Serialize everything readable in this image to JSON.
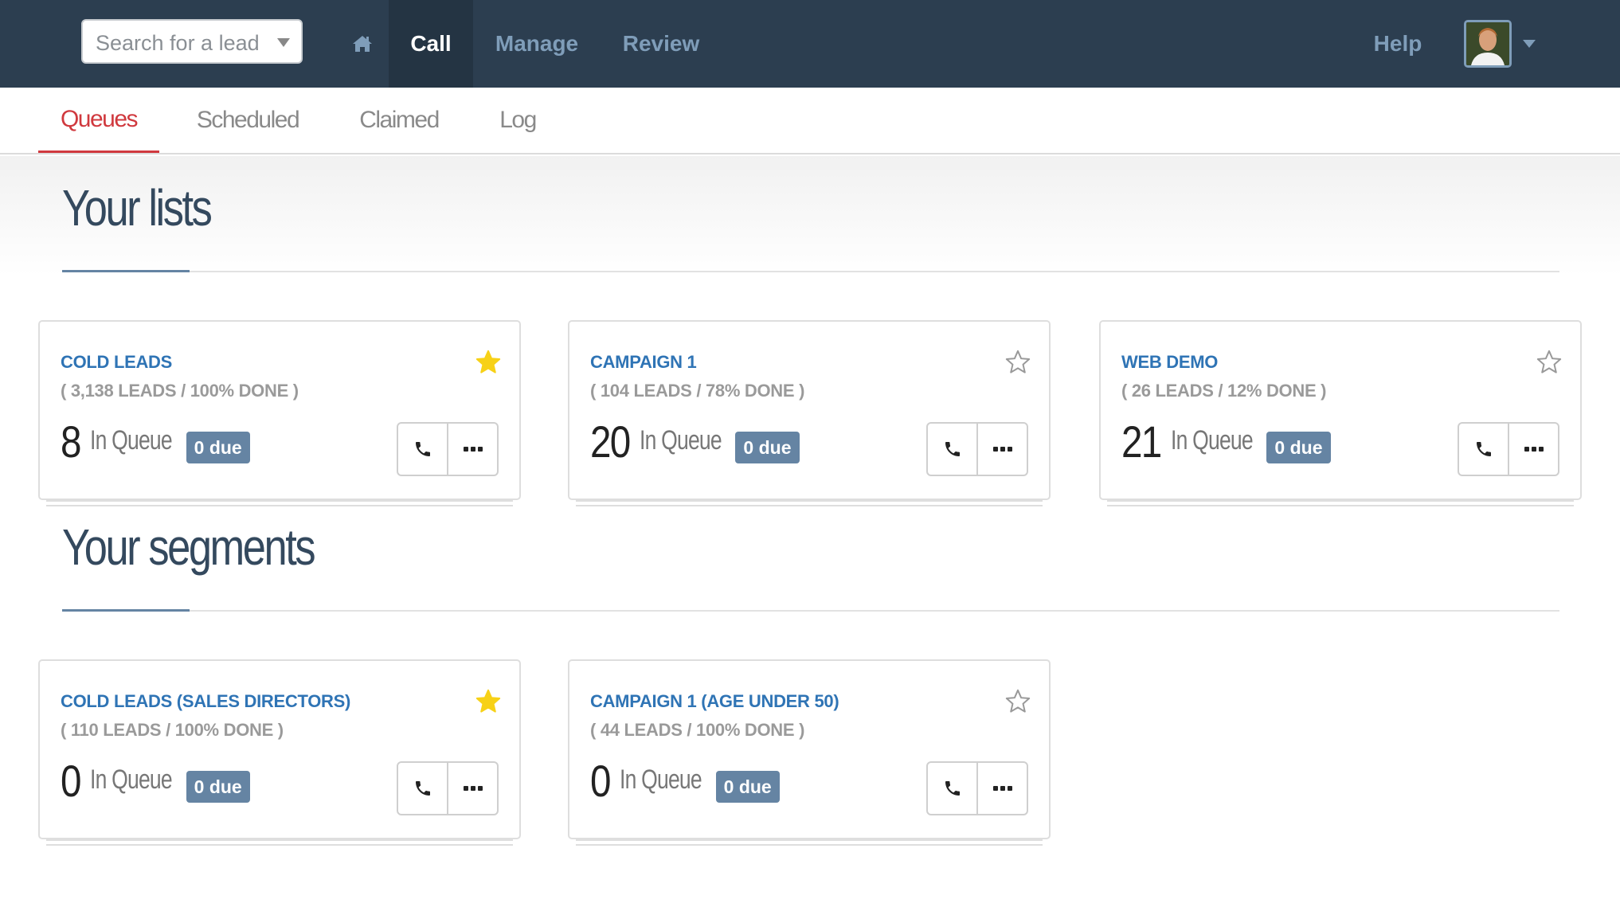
{
  "topnav": {
    "search_placeholder": "Search for a lead",
    "home_icon": "home-icon",
    "items": [
      {
        "label": "Call",
        "active": true
      },
      {
        "label": "Manage",
        "active": false
      },
      {
        "label": "Review",
        "active": false
      }
    ],
    "help_label": "Help",
    "avatar_icon": "user-avatar",
    "colors": {
      "bar": "#2c3e50",
      "active_bg": "#243443",
      "link": "#7f9db9"
    }
  },
  "subtabs": [
    {
      "label": "Queues",
      "active": true
    },
    {
      "label": "Scheduled",
      "active": false
    },
    {
      "label": "Claimed",
      "active": false
    },
    {
      "label": "Log",
      "active": false
    }
  ],
  "sections": {
    "lists": {
      "title": "Your lists",
      "cards": [
        {
          "name": "COLD LEADS",
          "stats": "( 3,138 LEADS / 100% DONE )",
          "queue_count": "8",
          "queue_label": "In Queue",
          "due": "0 due",
          "starred": true
        },
        {
          "name": "CAMPAIGN 1",
          "stats": "( 104 LEADS / 78% DONE )",
          "queue_count": "20",
          "queue_label": "In Queue",
          "due": "0 due",
          "starred": false
        },
        {
          "name": "WEB DEMO",
          "stats": "( 26 LEADS / 12% DONE )",
          "queue_count": "21",
          "queue_label": "In Queue",
          "due": "0 due",
          "starred": false
        }
      ]
    },
    "segments": {
      "title": "Your segments",
      "cards": [
        {
          "name": "COLD LEADS (SALES DIRECTORS)",
          "stats": "( 110 LEADS / 100% DONE )",
          "queue_count": "0",
          "queue_label": "In Queue",
          "due": "0 due",
          "starred": true
        },
        {
          "name": "CAMPAIGN 1 (AGE UNDER 50)",
          "stats": "( 44 LEADS / 100% DONE )",
          "queue_count": "0",
          "queue_label": "In Queue",
          "due": "0 due",
          "starred": false
        }
      ]
    }
  },
  "colors": {
    "accent_red": "#d0393e",
    "card_title": "#2f74b5",
    "badge": "#6584a3",
    "star_filled": "#f7d117",
    "heading": "#34495e"
  }
}
